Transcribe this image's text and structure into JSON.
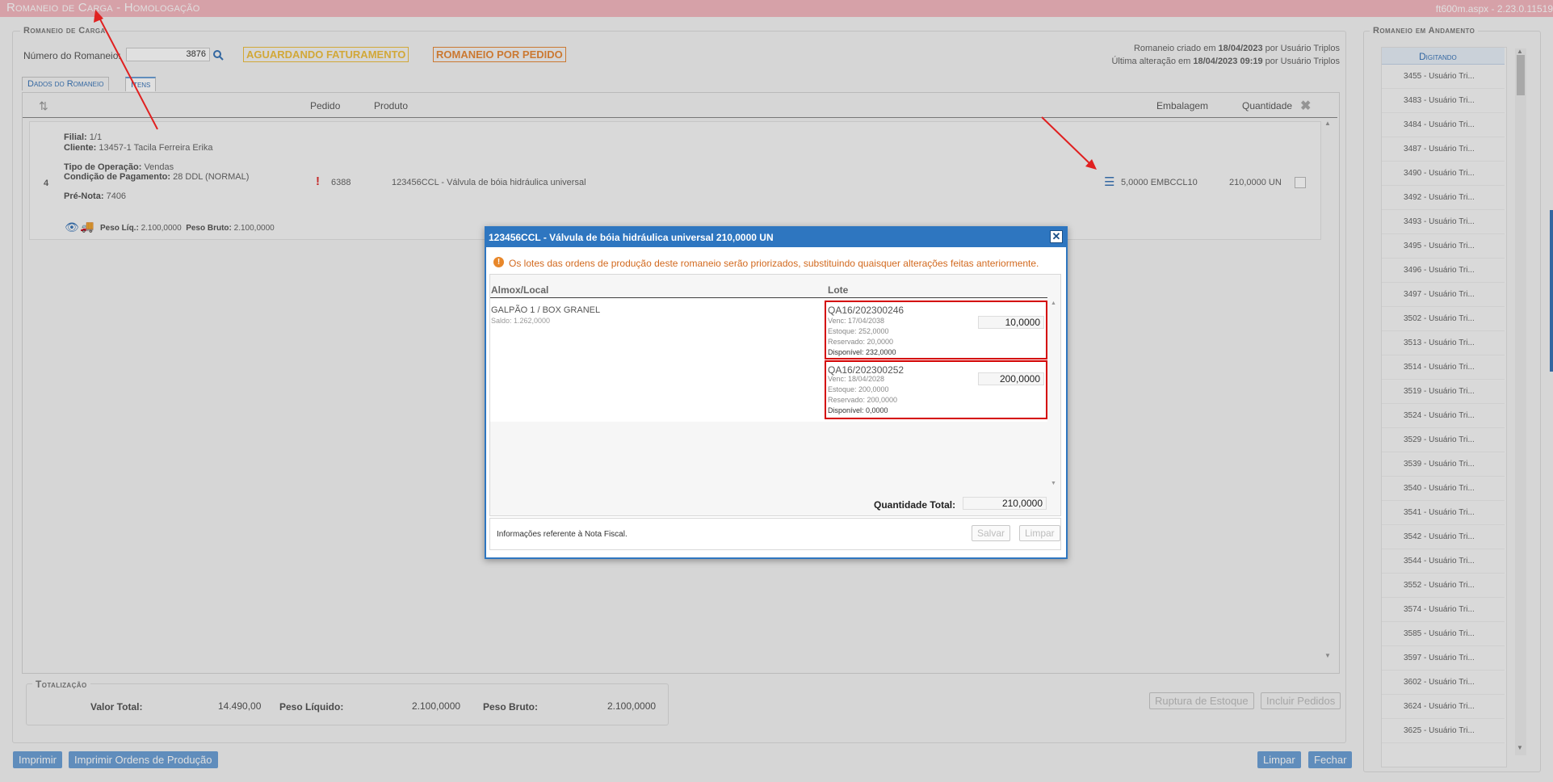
{
  "app": {
    "title": "Romaneio de Carga   - Homologação",
    "version": "ft600m.aspx - 2.23.0.11519"
  },
  "romaneio": {
    "legend": "Romaneio de Carga",
    "numero_label": "Número do Romaneio:",
    "numero_value": "3876",
    "status_badge": "AGUARDANDO FATURAMENTO",
    "tipo_badge": "ROMANEIO POR PEDIDO",
    "created_prefix": "Romaneio criado em",
    "created_date": "18/04/2023",
    "created_suffix": "por Usuário Triplos",
    "changed_prefix": "Última alteração em",
    "changed_date": "18/04/2023 09:19",
    "changed_suffix": "por Usuário Triplos"
  },
  "tabs": [
    "Dados do Romaneio",
    "Itens"
  ],
  "table": {
    "headers": {
      "pedido": "Pedido",
      "produto": "Produto",
      "embalagem": "Embalagem",
      "quantidade": "Quantidade"
    },
    "row": {
      "index": "4",
      "filial_label": "Filial:",
      "filial": "1/1",
      "cliente_label": "Cliente:",
      "cliente": "13457-1 Tacila Ferreira Erika",
      "tipo_label": "Tipo de Operação:",
      "tipo": "Vendas",
      "cond_label": "Condição de Pagamento:",
      "cond": "28 DDL (NORMAL)",
      "prenota_label": "Pré-Nota:",
      "prenota": "7406",
      "peso_liq_label": "Peso Líq.:",
      "peso_liq": "2.100,0000",
      "peso_bruto_label": "Peso Bruto:",
      "peso_bruto": "2.100,0000",
      "pedido": "6388",
      "produto": "123456CCL - Válvula de bóia hidráulica universal",
      "embalagem": "5,0000 EMBCCL10",
      "quantidade": "210,0000 UN"
    }
  },
  "totalizacao": {
    "legend": "Totalização",
    "valor_total_label": "Valor Total:",
    "valor_total": "14.490,00",
    "peso_liquido_label": "Peso Líquido:",
    "peso_liquido": "2.100,0000",
    "peso_bruto_label": "Peso Bruto:",
    "peso_bruto": "2.100,0000"
  },
  "buttons": {
    "ruptura": "Ruptura de Estoque",
    "incluir": "Incluir Pedidos",
    "imprimir": "Imprimir",
    "imprimir_ordens": "Imprimir Ordens de Produção",
    "limpar": "Limpar",
    "fechar": "Fechar"
  },
  "sidebar": {
    "legend": "Romaneio em Andamento",
    "header": "Digitando",
    "items": [
      "3455 - Usuário Tri...",
      "3483 - Usuário Tri...",
      "3484 - Usuário Tri...",
      "3487 - Usuário Tri...",
      "3490 - Usuário Tri...",
      "3492 - Usuário Tri...",
      "3493 - Usuário Tri...",
      "3495 - Usuário Tri...",
      "3496 - Usuário Tri...",
      "3497 - Usuário Tri...",
      "3502 - Usuário Tri...",
      "3513 - Usuário Tri...",
      "3514 - Usuário Tri...",
      "3519 - Usuário Tri...",
      "3524 - Usuário Tri...",
      "3529 - Usuário Tri...",
      "3539 - Usuário Tri...",
      "3540 - Usuário Tri...",
      "3541 - Usuário Tri...",
      "3542 - Usuário Tri...",
      "3544 - Usuário Tri...",
      "3552 - Usuário Tri...",
      "3574 - Usuário Tri...",
      "3585 - Usuário Tri...",
      "3597 - Usuário Tri...",
      "3602 - Usuário Tri...",
      "3624 - Usuário Tri...",
      "3625 - Usuário Tri..."
    ]
  },
  "modal": {
    "title": "123456CCL - Válvula de bóia hidráulica universal 210,0000 UN",
    "warning": "Os lotes das ordens de produção deste romaneio serão priorizados, substituindo quaisquer alterações feitas anteriormente.",
    "col_almox": "Almox/Local",
    "col_lote": "Lote",
    "almox": "GALPÃO 1 / BOX GRANEL",
    "saldo": "Saldo: 1.262,0000",
    "lotes": [
      {
        "code": "QA16/202300246",
        "venc": "Venc: 17/04/2038",
        "estoque": "Estoque: 252,0000",
        "reservado": "Reservado: 20,0000",
        "disponivel": "Disponível: 232,0000",
        "qty": "10,0000"
      },
      {
        "code": "QA16/202300252",
        "venc": "Venc: 18/04/2028",
        "estoque": "Estoque: 200,0000",
        "reservado": "Reservado: 200,0000",
        "disponivel": "Disponível: 0,0000",
        "qty": "200,0000"
      }
    ],
    "qtd_total_label": "Quantidade Total:",
    "qtd_total": "210,0000",
    "footer_info": "Informações referente à Nota Fiscal.",
    "salvar": "Salvar",
    "limpar": "Limpar"
  },
  "colors": {
    "accent": "#2e76c0",
    "highlight": "#d40000",
    "titlebar": "#f4b8c0"
  }
}
